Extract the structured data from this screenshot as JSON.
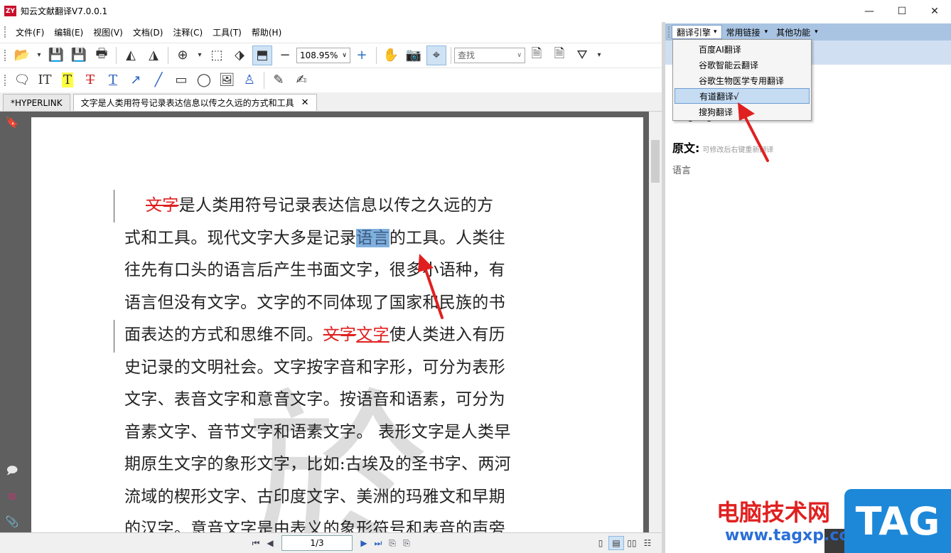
{
  "window": {
    "title": "知云文献翻译V7.0.0.1",
    "logo": "ZY"
  },
  "menu": [
    "文件(F)",
    "编辑(E)",
    "视图(V)",
    "文档(D)",
    "注释(C)",
    "工具(T)",
    "帮助(H)"
  ],
  "toolbar": {
    "zoom": "108.95%",
    "find_placeholder": "查找"
  },
  "tabs": [
    {
      "label": "*HYPERLINK",
      "active": false
    },
    {
      "label": "文字是人类用符号记录表达信息以传之久远的方式和工具",
      "active": true
    }
  ],
  "document": {
    "lines": [
      {
        "segments": [
          {
            "t": "文字",
            "style": "strike"
          },
          {
            "t": "是人类用符号记录表达信息以传之久远的方",
            "style": ""
          }
        ]
      },
      {
        "segments": [
          {
            "t": "式和工具。现代文字大多是记录",
            "style": ""
          },
          {
            "t": "语言",
            "style": "hl"
          },
          {
            "t": "的工具。人类往",
            "style": ""
          }
        ]
      },
      {
        "segments": [
          {
            "t": "往先有口头的语言后产生书面文字，很多小语种，有",
            "style": ""
          }
        ]
      },
      {
        "segments": [
          {
            "t": "语言但没有文字。文字的不同体现了国家和民族的书",
            "style": ""
          }
        ]
      },
      {
        "segments": [
          {
            "t": "面表达的方式和思维不同。",
            "style": ""
          },
          {
            "t": "文字",
            "style": "strike"
          },
          {
            "t": "文字",
            "style": "uline"
          },
          {
            "t": "使人类进入有历",
            "style": ""
          }
        ]
      },
      {
        "segments": [
          {
            "t": "史记录的文明社会。文字按字音和字形，可分为表形",
            "style": ""
          }
        ]
      },
      {
        "segments": [
          {
            "t": "文字、表音文字和意音文字。按语音和语素，可分为",
            "style": ""
          }
        ]
      },
      {
        "segments": [
          {
            "t": "音素文字、音节文字和语素文字。 表形文字是人类早",
            "style": ""
          }
        ]
      },
      {
        "segments": [
          {
            "t": "期原生文字的象形文字，比如:古埃及的圣书字、两河",
            "style": ""
          }
        ]
      },
      {
        "segments": [
          {
            "t": "流域的楔形文字、古印度文字、美洲的玛雅文和早期",
            "style": ""
          }
        ]
      },
      {
        "segments": [
          {
            "t": "的汉字。意音文字是由表义的象形符号和表音的声旁",
            "style": ""
          }
        ]
      }
    ],
    "watermark": "於"
  },
  "statusbar": {
    "page": "1/3"
  },
  "right_panel": {
    "toolbar": [
      {
        "label": "翻译引擎",
        "active": true
      },
      {
        "label": "常用链接",
        "active": false
      },
      {
        "label": "其他功能",
        "active": false
      }
    ],
    "engines": [
      {
        "label": "百度AI翻译",
        "selected": false
      },
      {
        "label": "谷歌智能云翻译",
        "selected": false
      },
      {
        "label": "谷歌生物医学专用翻译",
        "selected": false
      },
      {
        "label": "有道翻译√",
        "selected": true
      },
      {
        "label": "搜狗翻译",
        "selected": false
      }
    ],
    "translation": "language",
    "original_label": "原文:",
    "original_hint": "可修改后右键重新翻译",
    "original_text": "语言"
  },
  "watermark_brand": {
    "text": "电脑技术网",
    "url": "www.tagxp.com",
    "badge": "TAG"
  }
}
